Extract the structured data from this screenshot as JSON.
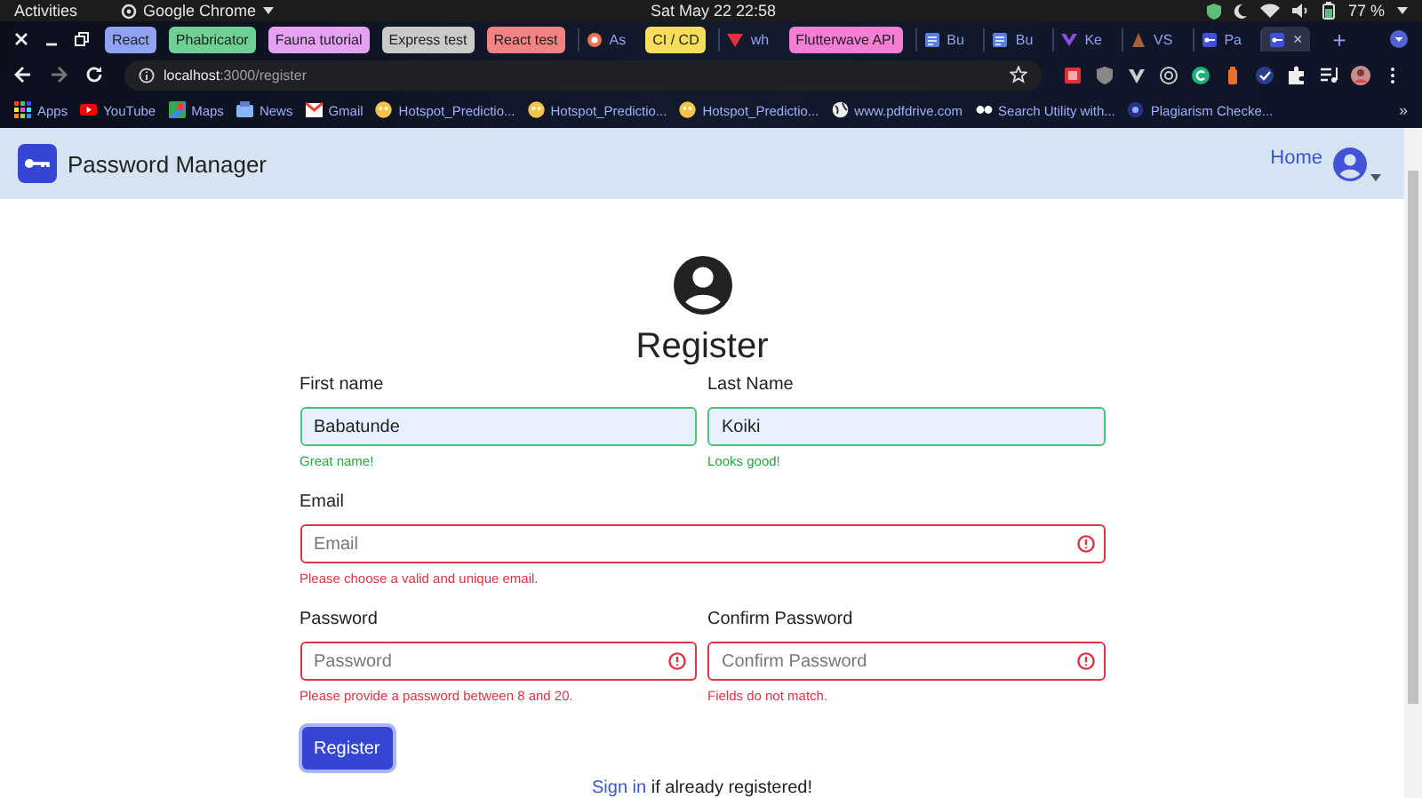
{
  "system_bar": {
    "activities": "Activities",
    "app": "Google Chrome",
    "clock": "Sat May 22  22:58",
    "battery": "77 %"
  },
  "browser": {
    "tabs": [
      {
        "kind": "group",
        "label": "React",
        "color": "#8fa3f2",
        "selected": false
      },
      {
        "kind": "group",
        "label": "Phabricator",
        "color": "#6fd094",
        "selected": false
      },
      {
        "kind": "group",
        "label": "Fauna tutorial",
        "color": "#e6a2f2",
        "selected": false
      },
      {
        "kind": "group",
        "label": "Express test",
        "color": "#cacaca",
        "selected": false
      },
      {
        "kind": "group",
        "label": "React test",
        "color": "#f38383",
        "selected": false
      },
      {
        "kind": "tab",
        "label": "As",
        "selected": false
      },
      {
        "kind": "group",
        "label": "CI / CD",
        "color": "#f6de5c",
        "selected": false
      },
      {
        "kind": "tab",
        "label": "wh",
        "selected": false
      },
      {
        "kind": "group",
        "label": "Flutterwave API",
        "color": "#f47ed4",
        "selected": false
      },
      {
        "kind": "tab",
        "label": "Bu",
        "selected": false
      },
      {
        "kind": "tab",
        "label": "Bu",
        "selected": false
      },
      {
        "kind": "tab",
        "label": "Ke",
        "selected": false
      },
      {
        "kind": "tab",
        "label": "VS",
        "selected": false
      },
      {
        "kind": "tab",
        "label": "Pa",
        "selected": false
      },
      {
        "kind": "tab",
        "close": "×",
        "selected": true
      }
    ],
    "new_tab": "+",
    "url_host": "localhost",
    "url_path": ":3000/register",
    "bookmarks": [
      "Apps",
      "YouTube",
      "Maps",
      "News",
      "Gmail",
      "Hotspot_Predictio...",
      "Hotspot_Predictio...",
      "Hotspot_Predictio...",
      "www.pdfdrive.com",
      "Search Utility with...",
      "Plagiarism Checke..."
    ],
    "more": "»"
  },
  "navbar": {
    "brand": "Password Manager",
    "link": "Home"
  },
  "form": {
    "title": "Register",
    "rows": [
      [
        {
          "label": "First name",
          "value": "Babatunde",
          "valid": true,
          "feedback": "Great name!"
        },
        {
          "label": "Last Name",
          "value": "Koiki",
          "valid": true,
          "feedback": "Looks good!"
        }
      ],
      [
        {
          "label": "Email",
          "placeholder": "Email",
          "valid": false,
          "feedback": "Please choose a valid and unique email."
        }
      ],
      [
        {
          "label": "Password",
          "placeholder": "Password",
          "valid": false,
          "feedback": "Please provide a password between 8 and 20."
        },
        {
          "label": "Confirm Password",
          "placeholder": "Confirm Password",
          "valid": false,
          "feedback": "Fields do not match."
        }
      ]
    ],
    "submit": "Register",
    "signin_link": "Sign in",
    "signin_text": "if already registered!"
  }
}
